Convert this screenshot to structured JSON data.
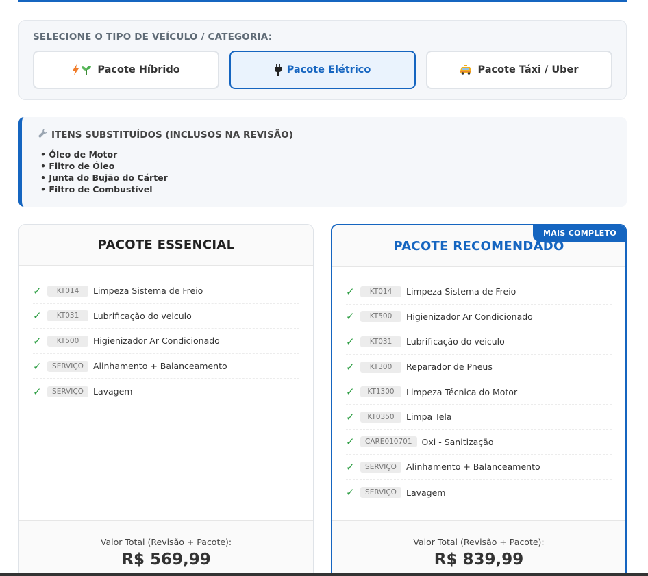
{
  "category": {
    "title": "SELECIONE O TIPO DE VEÍCULO / CATEGORIA:",
    "options": [
      {
        "label": "Pacote Híbrido",
        "icon": "bolt-sprout-icon",
        "selected": false
      },
      {
        "label": "Pacote Elétrico",
        "icon": "plug-icon",
        "selected": true
      },
      {
        "label": "Pacote Táxi / Uber",
        "icon": "taxi-icon",
        "selected": false
      }
    ],
    "accent": "#1565c0"
  },
  "replaced_items": {
    "title": "ITENS SUBSTITUÍDOS (INCLUSOS NA REVISÃO)",
    "icon": "wrench-icon",
    "items": [
      "Óleo de Motor",
      "Filtro de Óleo",
      "Junta do Bujão do Cárter",
      "Filtro de Combustível"
    ]
  },
  "packages": [
    {
      "title": "PACOTE ESSENCIAL",
      "badge": "",
      "services": [
        {
          "code": "KT014",
          "name": "Limpeza Sistema de Freio"
        },
        {
          "code": "KT031",
          "name": "Lubrificação do veiculo"
        },
        {
          "code": "KT500",
          "name": "Higienizador Ar Condicionado"
        },
        {
          "code": "SERVIÇO",
          "name": "Alinhamento + Balanceamento"
        },
        {
          "code": "SERVIÇO",
          "name": "Lavagem"
        }
      ],
      "total_label": "Valor Total (Revisão + Pacote):",
      "total_value": "R$ 569,99"
    },
    {
      "title": "PACOTE RECOMENDADO",
      "badge": "MAIS COMPLETO",
      "services": [
        {
          "code": "KT014",
          "name": "Limpeza Sistema de Freio"
        },
        {
          "code": "KT500",
          "name": "Higienizador Ar Condicionado"
        },
        {
          "code": "KT031",
          "name": "Lubrificação do veiculo"
        },
        {
          "code": "KT300",
          "name": "Reparador de Pneus"
        },
        {
          "code": "KT1300",
          "name": "Limpeza Técnica do Motor"
        },
        {
          "code": "KT0350",
          "name": "Limpa Tela"
        },
        {
          "code": "CARE010701",
          "name": "Oxi - Sanitização"
        },
        {
          "code": "SERVIÇO",
          "name": "Alinhamento + Balanceamento"
        },
        {
          "code": "SERVIÇO",
          "name": "Lavagem"
        }
      ],
      "total_label": "Valor Total (Revisão + Pacote):",
      "total_value": "R$ 839,99"
    }
  ],
  "colors": {
    "check": "#2e9e44",
    "primary": "#1565c0"
  }
}
